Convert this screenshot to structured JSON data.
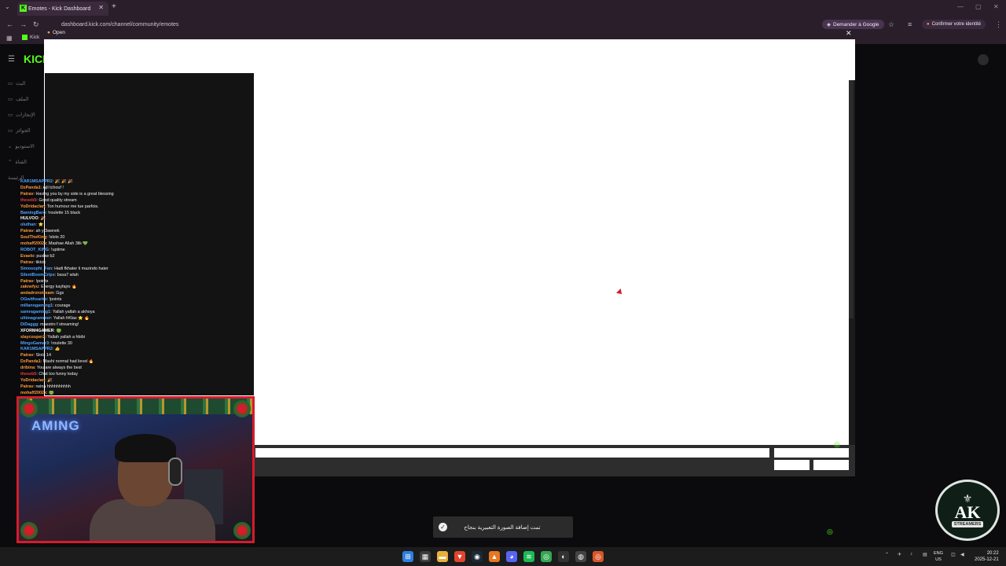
{
  "browser": {
    "tab_title": "Emotes - Kick Dashboard",
    "url": "dashboard.kick.com/channel/community/emotes",
    "google_button": "Demander à Google",
    "confirm_button": "Confirmer votre identité",
    "bookmark": "Kick"
  },
  "dialog": {
    "title": "Open"
  },
  "sidebar": {
    "items": [
      "البث",
      "الملف",
      "الإنجازات",
      "الجوائز",
      "الاستوديو",
      "القناة",
      "الرئيسة"
    ]
  },
  "chat": [
    {
      "user": "KAR1MSAPPR2",
      "color": "#4fa3ff",
      "msg": "🎉 🎉 🎉"
    },
    {
      "user": "DzPanda1",
      "color": "#ff9a3c",
      "msg": "Ajil tchouf !"
    },
    {
      "user": "Patrav",
      "color": "#ff9a3c",
      "msg": "Having you by my side is a great blessing"
    },
    {
      "user": "theseb5",
      "color": "#e63b3b",
      "msg": "Good quality stream"
    },
    {
      "user": "YoDridaclan",
      "color": "#ff9a3c",
      "msg": "Ton humour me tue parfois."
    },
    {
      "user": "BamingBaro",
      "color": "#4fa3ff",
      "msg": "!roulette 15 black"
    },
    {
      "user": "HULVOO",
      "color": "#ffffff",
      "msg": "🎉"
    },
    {
      "user": "oluthan",
      "color": "#4fa3ff",
      "msg": "⭐"
    },
    {
      "user": "Patrav",
      "color": "#ff9a3c",
      "msg": "ah y 3awnek"
    },
    {
      "user": "SoulTheKing",
      "color": "#ff9a3c",
      "msg": "!slots 20"
    },
    {
      "user": "mohaff2002x",
      "color": "#ff9a3c",
      "msg": "Mashae Allah 3lik 💚"
    },
    {
      "user": "ROBOT_KING",
      "color": "#4fa3ff",
      "msg": "!uptime"
    },
    {
      "user": "Evaelo",
      "color": "#ff9a3c",
      "msg": "pushw b2"
    },
    {
      "user": "Patrav",
      "color": "#ff9a3c",
      "msg": "tiktok"
    },
    {
      "user": "Simosophi_Fan",
      "color": "#4fa3ff",
      "msg": "Hadi fkhater li mazindo hater"
    },
    {
      "user": "SilentBoomCrips",
      "color": "#4fa3ff",
      "msg": "bssa7 wlah"
    },
    {
      "user": "Patrav",
      "color": "#ff9a3c",
      "msg": "!points"
    },
    {
      "user": "zaknefyu",
      "color": "#ff9a3c",
      "msg": "Energy kayfajro 🔥"
    },
    {
      "user": "andadronxtream",
      "color": "#ff9a3c",
      "msg": "Ggs"
    },
    {
      "user": "OGwithsarko",
      "color": "#4fa3ff",
      "msg": "!points"
    },
    {
      "user": "millanogaming1",
      "color": "#4fa3ff",
      "msg": "courage"
    },
    {
      "user": "samragaming1",
      "color": "#4fa3ff",
      "msg": "Yallah yallah a akhoya"
    },
    {
      "user": "ultimagrammer",
      "color": "#4fa3ff",
      "msg": "Yallah frKlas ⭐ 🔥"
    },
    {
      "user": "DiDaggg",
      "color": "#4fa3ff",
      "msg": "maestro f streaming!"
    },
    {
      "user": "XFORM4GAMER",
      "color": "#ffffff",
      "msg": "🟢"
    },
    {
      "user": "slaycouper2",
      "color": "#ff9a3c",
      "msg": "Yallah yallah a hbibi"
    },
    {
      "user": "MingoGamer3",
      "color": "#4fa3ff",
      "msg": "!roulette 30"
    },
    {
      "user": "KAR1MSAPPR2",
      "color": "#4fa3ff",
      "msg": "👍"
    },
    {
      "user": "Patrav",
      "color": "#ff9a3c",
      "msg": "Slots 14"
    },
    {
      "user": "DzPanda1",
      "color": "#ff9a3c",
      "msg": "Mashi normal had lievel 🔥"
    },
    {
      "user": "dribina",
      "color": "#ff9a3c",
      "msg": "You are always the best"
    },
    {
      "user": "theseb5",
      "color": "#e63b3b",
      "msg": "Chat too funny today"
    },
    {
      "user": "YoDridaclan",
      "color": "#ff9a3c",
      "msg": "🎉"
    },
    {
      "user": "Patrav",
      "color": "#ff9a3c",
      "msg": "rwina hhhhhhhhhh"
    },
    {
      "user": "mohaff2002x",
      "color": "#ff9a3c",
      "msg": "🟢"
    }
  ],
  "webcam": {
    "sign": "AMING"
  },
  "toast": {
    "text": "تمت إضافة الصورة التعبيرية بنجاح"
  },
  "logo": {
    "text": "AK",
    "sub": "STREAMERS"
  },
  "taskbar": {
    "lang": "ENG",
    "region": "US",
    "time": "20:22",
    "date": "2025-12-21"
  },
  "colors": {
    "kick_green": "#53fc18",
    "webcam_border": "#d61b2b"
  }
}
